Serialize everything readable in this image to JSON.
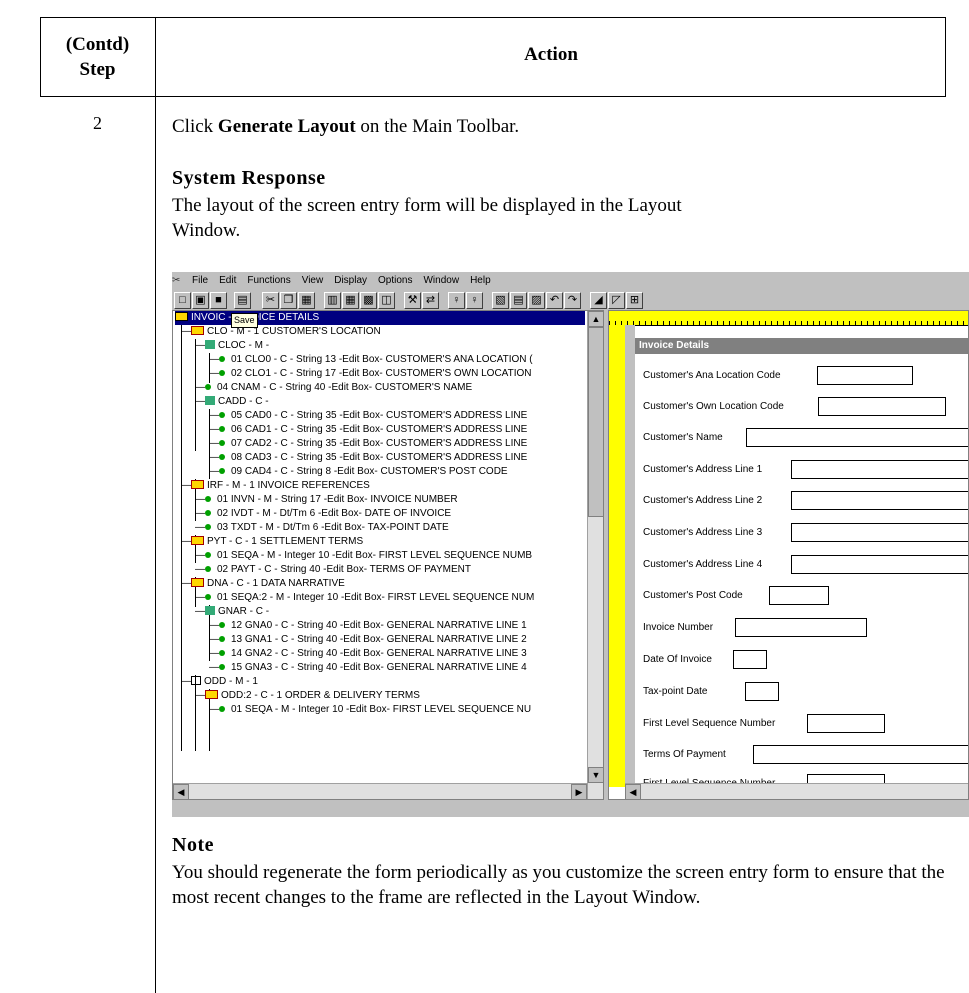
{
  "header": {
    "step_col_line1": "(Contd)",
    "step_col_line2": "Step",
    "action_col": "Action"
  },
  "step": "2",
  "instruction": {
    "prefix": "Click ",
    "bold": "Generate Layout",
    "suffix": " on the Main Toolbar."
  },
  "system_response": {
    "heading": "System Response",
    "text": "The layout of the screen entry form will be displayed in the Layout Window."
  },
  "screenshot": {
    "menu": [
      "File",
      "Edit",
      "Functions",
      "View",
      "Display",
      "Options",
      "Window",
      "Help"
    ],
    "tooltip": "Save",
    "tree_title": "INVOIC -           INVOICE DETAILS",
    "tree": [
      "CLO - M - 1 CUSTOMER'S LOCATION",
      "CLOC - M -",
      "01 CLO0 - C - String 13 -Edit Box- CUSTOMER'S ANA LOCATION (",
      "02 CLO1 - C - String 17 -Edit Box- CUSTOMER'S OWN LOCATION",
      "04 CNAM - C - String 40 -Edit Box- CUSTOMER'S NAME",
      "CADD - C -",
      "05 CAD0 - C - String 35 -Edit Box- CUSTOMER'S ADDRESS LINE",
      "06 CAD1 - C - String 35 -Edit Box- CUSTOMER'S ADDRESS LINE",
      "07 CAD2 - C - String 35 -Edit Box- CUSTOMER'S ADDRESS LINE",
      "08 CAD3 - C - String 35 -Edit Box- CUSTOMER'S ADDRESS LINE",
      "09 CAD4 - C - String 8 -Edit Box- CUSTOMER'S POST CODE",
      "IRF - M - 1 INVOICE REFERENCES",
      "01 INVN - M - String 17 -Edit Box- INVOICE NUMBER",
      "02 IVDT - M - Dt/Tm 6 -Edit Box- DATE OF INVOICE",
      "03 TXDT - M - Dt/Tm 6 -Edit Box- TAX-POINT DATE",
      "PYT - C - 1 SETTLEMENT TERMS",
      "01 SEQA - M - Integer 10 -Edit Box- FIRST LEVEL SEQUENCE NUMB",
      "02 PAYT - C - String 40 -Edit Box- TERMS OF PAYMENT",
      "DNA - C - 1 DATA NARRATIVE",
      "01 SEQA:2 - M - Integer 10 -Edit Box- FIRST LEVEL SEQUENCE NUM",
      "GNAR - C -",
      "12 GNA0 - C - String 40 -Edit Box- GENERAL NARRATIVE LINE 1",
      "13 GNA1 - C - String 40 -Edit Box- GENERAL NARRATIVE LINE 2",
      "14 GNA2 - C - String 40 -Edit Box- GENERAL NARRATIVE LINE 3",
      "15 GNA3 - C - String 40 -Edit Box- GENERAL NARRATIVE LINE 4",
      "ODD - M - 1",
      "ODD:2 - C - 1 ORDER & DELIVERY TERMS",
      "01 SEQA - M - Integer 10 -Edit Box- FIRST LEVEL SEQUENCE NU"
    ],
    "form_title": "Invoice Details",
    "fields": [
      "Customer's Ana Location Code",
      "Customer's Own Location Code",
      "Customer's Name",
      "Customer's Address Line 1",
      "Customer's Address Line 2",
      "Customer's Address Line 3",
      "Customer's Address Line 4",
      "Customer's Post Code",
      "Invoice Number",
      "Date Of Invoice",
      "Tax-point Date",
      "First Level Sequence Number",
      "Terms Of Payment",
      "First Level Sequence Number"
    ]
  },
  "note": {
    "heading": "Note",
    "text": "You should regenerate the form periodically as you customize the screen entry form to ensure that the most recent changes to the frame are reflected in the Layout Window."
  }
}
